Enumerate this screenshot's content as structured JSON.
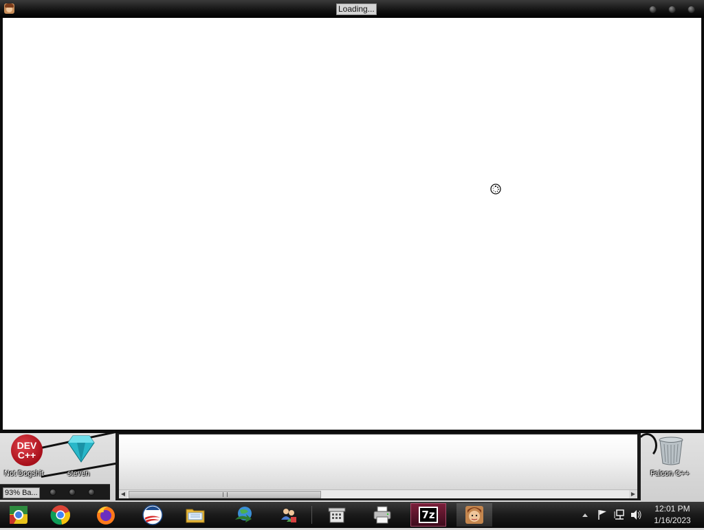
{
  "window": {
    "title": "Loading..."
  },
  "desktop": {
    "icons": [
      {
        "label": "Not Dogshit",
        "icon": "dev-cpp-icon"
      },
      {
        "label": "steven",
        "icon": "diamond-gem-icon"
      },
      {
        "label": "Falcon C++",
        "icon": "recycle-bin-icon"
      }
    ]
  },
  "minimized_window": {
    "title": "93% Ba..."
  },
  "taskbar": {
    "items": [
      {
        "name": "chromium",
        "icon": "chromium-icon"
      },
      {
        "name": "chrome",
        "icon": "chrome-icon"
      },
      {
        "name": "firefox",
        "icon": "firefox-icon"
      },
      {
        "name": "obama",
        "icon": "obama-logo-icon"
      },
      {
        "name": "file-explorer",
        "icon": "folder-icon"
      },
      {
        "name": "internet-download-manager",
        "icon": "globe-arrow-icon"
      },
      {
        "name": "users",
        "icon": "users-icon"
      },
      {
        "name": "cash-register",
        "icon": "cash-register-icon"
      },
      {
        "name": "printer",
        "icon": "printer-icon"
      },
      {
        "name": "7zip",
        "icon": "seven-zip-icon",
        "text": "7z"
      },
      {
        "name": "game-app",
        "icon": "character-face-icon"
      }
    ],
    "clock": {
      "time": "12:01 PM",
      "date": "1/16/2023"
    }
  }
}
